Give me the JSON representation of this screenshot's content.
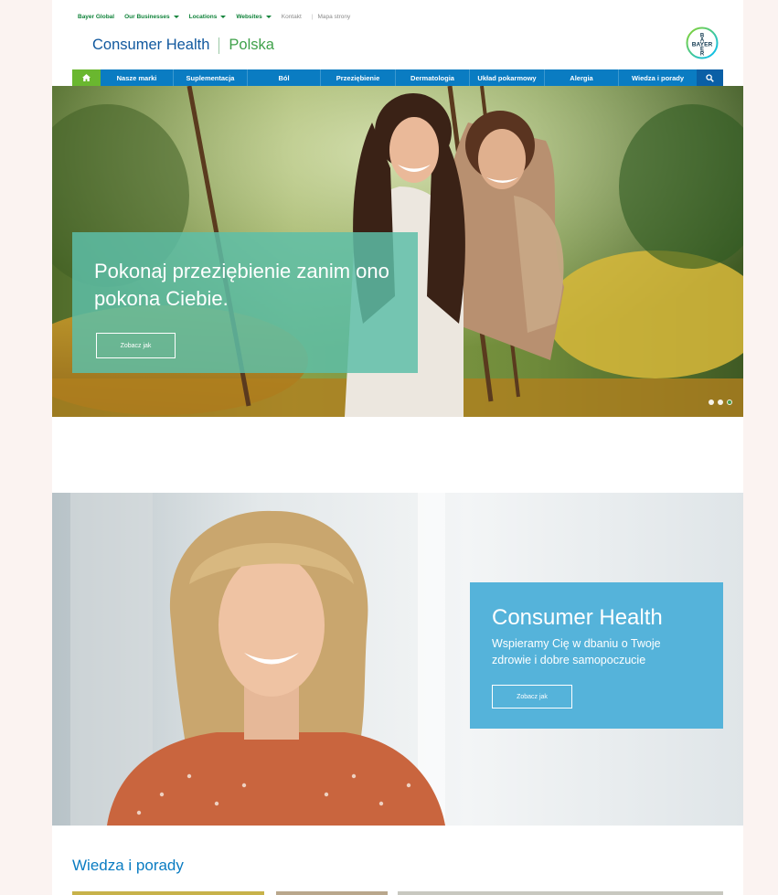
{
  "topbar": {
    "links": [
      {
        "label": "Bayer Global",
        "dropdown": false
      },
      {
        "label": "Our Businesses",
        "dropdown": true
      },
      {
        "label": "Locations",
        "dropdown": true
      },
      {
        "label": "Websites",
        "dropdown": true
      }
    ],
    "kontakt": "Kontakt",
    "separator": "|",
    "mapa": "Mapa strony"
  },
  "brand": {
    "name": "Consumer Health",
    "country": "Polska"
  },
  "logo": {
    "text": "BAYER",
    "top_letters": [
      "B",
      "A"
    ],
    "bottom_letters": [
      "E",
      "R"
    ]
  },
  "nav": {
    "home_icon": "home-icon",
    "search_icon": "search-icon",
    "items": [
      "Nasze marki",
      "Suplementacja",
      "Ból",
      "Przeziębienie",
      "Dermatologia",
      "Układ pokarmowy",
      "Alergia",
      "Wiedza i porady"
    ]
  },
  "hero": {
    "title": "Pokonaj przeziębienie zanim ono pokona Ciebie.",
    "button": "Zobacz jak",
    "slides_total": 3,
    "active_slide": 3
  },
  "promo": {
    "title": "Consumer Health",
    "subtitle": "Wspieramy Cię w dbaniu o Twoje zdrowie i dobre samopoczucie",
    "button": "Zobacz jak"
  },
  "section": {
    "title": "Wiedza i porady"
  },
  "colors": {
    "nav_blue": "#0a7cc2",
    "home_green": "#6ab72f",
    "brand_blue": "#10589e",
    "brand_green": "#3fa14a",
    "hero_overlay": "#5dbfa8",
    "promo_box": "#55b3da"
  }
}
